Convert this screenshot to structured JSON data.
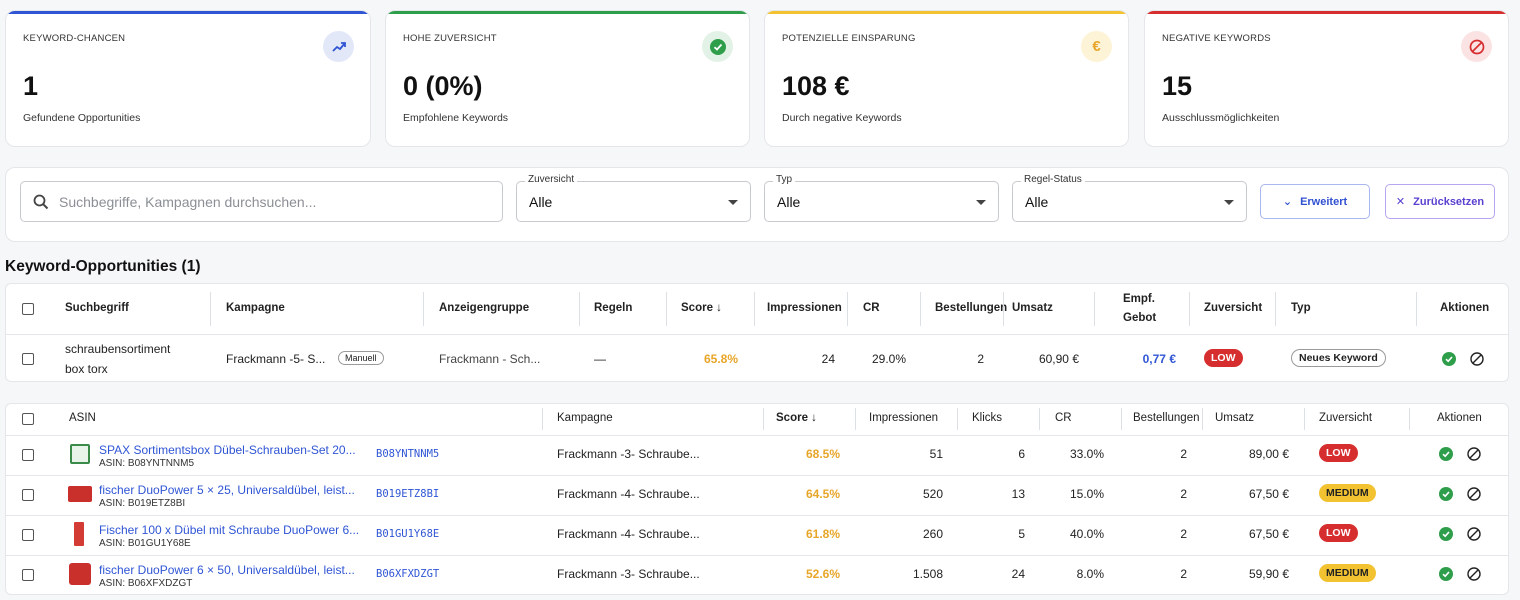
{
  "kpis": [
    {
      "label": "KEYWORD-CHANCEN",
      "value": "1",
      "sub": "Gefundene Opportunities",
      "color": "#2f55d4",
      "icon": "trending-up-icon"
    },
    {
      "label": "HOHE ZUVERSICHT",
      "value": "0 (0%)",
      "sub": "Empfohlene Keywords",
      "color": "#2e9e4b",
      "icon": "check-circle-icon"
    },
    {
      "label": "POTENZIELLE EINSPARUNG",
      "value": "108 €",
      "sub": "Durch negative Keywords",
      "color": "#f2c230",
      "icon": "euro-icon"
    },
    {
      "label": "NEGATIVE KEYWORDS",
      "value": "15",
      "sub": "Ausschlussmöglichkeiten",
      "color": "#d62e2e",
      "icon": "block-icon"
    }
  ],
  "filters": {
    "search_placeholder": "Suchbegriffe, Kampagnen durchsuchen...",
    "selects": [
      {
        "label": "Zuversicht",
        "value": "Alle"
      },
      {
        "label": "Typ",
        "value": "Alle"
      },
      {
        "label": "Regel-Status",
        "value": "Alle"
      }
    ],
    "advanced_label": "Erweitert",
    "reset_label": "Zurücksetzen"
  },
  "section_title": "Keyword-Opportunities (1)",
  "keyword_table": {
    "headers": {
      "term": "Suchbegriff",
      "campaign": "Kampagne",
      "adgroup": "Anzeigengruppe",
      "rules": "Regeln",
      "score": "Score ↓",
      "impressions": "Impressionen",
      "cr": "CR",
      "orders": "Bestellungen",
      "revenue": "Umsatz",
      "bid_line1": "Empf.",
      "bid_line2": "Gebot",
      "confidence": "Zuversicht",
      "type": "Typ",
      "actions": "Aktionen"
    },
    "rows": [
      {
        "term_line1": "schraubensortiment",
        "term_line2": "box torx",
        "campaign": "Frackmann -5- S...",
        "campaign_tag": "Manuell",
        "adgroup": "Frackmann - Sch...",
        "rules": "—",
        "score": "65.8%",
        "impressions": "24",
        "cr": "29.0%",
        "orders": "2",
        "revenue": "60,90 €",
        "bid": "0,77 €",
        "confidence": "LOW",
        "type": "Neues Keyword"
      }
    ]
  },
  "asin_table": {
    "headers": {
      "asin": "ASIN",
      "campaign": "Kampagne",
      "score": "Score ↓",
      "impressions": "Impressionen",
      "clicks": "Klicks",
      "cr": "CR",
      "orders": "Bestellungen",
      "revenue": "Umsatz",
      "confidence": "Zuversicht",
      "actions": "Aktionen"
    },
    "rows": [
      {
        "title": "SPAX Sortimentsbox Dübel-Schrauben-Set 20...",
        "asin_sub": "ASIN: B08YNTNNM5",
        "asin": "B08YNTNNM5",
        "campaign": "Frackmann -3- Schraube...",
        "score": "68.5%",
        "impressions": "51",
        "clicks": "6",
        "cr": "33.0%",
        "orders": "2",
        "revenue": "89,00 €",
        "confidence": "LOW",
        "thumb_color": "#3a8a4a"
      },
      {
        "title": "fischer DuoPower 5 × 25, Universaldübel, leist...",
        "asin_sub": "ASIN: B019ETZ8BI",
        "asin": "B019ETZ8BI",
        "campaign": "Frackmann -4- Schraube...",
        "score": "64.5%",
        "impressions": "520",
        "clicks": "13",
        "cr": "15.0%",
        "orders": "2",
        "revenue": "67,50 €",
        "confidence": "MEDIUM",
        "thumb_color": "#c9302c"
      },
      {
        "title": "Fischer 100 x Dübel mit Schraube DuoPower 6...",
        "asin_sub": "ASIN: B01GU1Y68E",
        "asin": "B01GU1Y68E",
        "campaign": "Frackmann -4- Schraube...",
        "score": "61.8%",
        "impressions": "260",
        "clicks": "5",
        "cr": "40.0%",
        "orders": "2",
        "revenue": "67,50 €",
        "confidence": "LOW",
        "thumb_color": "#d33b35"
      },
      {
        "title": "fischer DuoPower 6 × 50, Universaldübel, leist...",
        "asin_sub": "ASIN: B06XFXDZGT",
        "asin": "B06XFXDZGT",
        "campaign": "Frackmann -3- Schraube...",
        "score": "52.6%",
        "impressions": "1.508",
        "clicks": "24",
        "cr": "8.0%",
        "orders": "2",
        "revenue": "59,90 €",
        "confidence": "MEDIUM",
        "thumb_color": "#c9302c"
      }
    ]
  }
}
